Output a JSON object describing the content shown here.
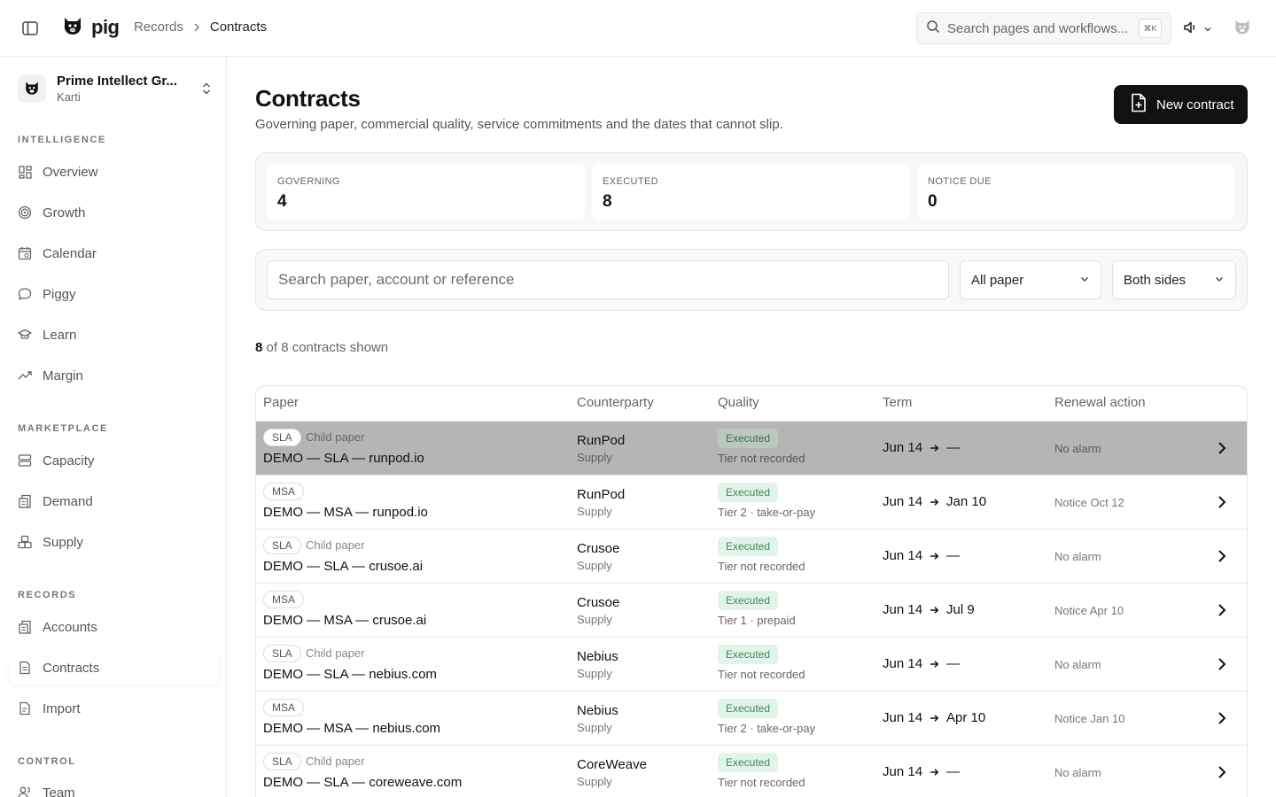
{
  "app": {
    "brand": "pig",
    "breadcrumb": {
      "parent": "Records",
      "current": "Contracts"
    },
    "search": {
      "placeholder": "Search pages and workflows...",
      "shortcut": "⌘K"
    }
  },
  "sidebar": {
    "org": {
      "name": "Prime Intellect Gr...",
      "user": "Karti"
    },
    "sections": {
      "intelligence": "INTELLIGENCE",
      "marketplace": "MARKETPLACE",
      "records": "RECORDS",
      "control": "CONTROL"
    },
    "items": {
      "overview": "Overview",
      "growth": "Growth",
      "calendar": "Calendar",
      "piggy": "Piggy",
      "learn": "Learn",
      "margin": "Margin",
      "capacity": "Capacity",
      "demand": "Demand",
      "supply": "Supply",
      "accounts": "Accounts",
      "contracts": "Contracts",
      "import": "Import",
      "team": "Team"
    }
  },
  "page": {
    "title": "Contracts",
    "subtitle": "Governing paper, commercial quality, service commitments and the dates that cannot slip.",
    "new_button": "New contract"
  },
  "stats": [
    {
      "label": "GOVERNING",
      "value": "4"
    },
    {
      "label": "EXECUTED",
      "value": "8"
    },
    {
      "label": "NOTICE DUE",
      "value": "0"
    }
  ],
  "filters": {
    "search_placeholder": "Search paper, account or reference",
    "paper_select": "All paper",
    "side_select": "Both sides"
  },
  "count": {
    "shown": "8",
    "rest": "of 8 contracts shown"
  },
  "table": {
    "headers": {
      "paper": "Paper",
      "counterparty": "Counterparty",
      "quality": "Quality",
      "term": "Term",
      "renewal": "Renewal action"
    },
    "rows": [
      {
        "type": "SLA",
        "child": "Child paper",
        "name": "DEMO — SLA — runpod.io",
        "counterparty": "RunPod",
        "side": "Supply",
        "status": "Executed",
        "tier": "Tier not recorded",
        "start": "Jun 14",
        "end": "—",
        "renewal": "No alarm"
      },
      {
        "type": "MSA",
        "child": "",
        "name": "DEMO — MSA — runpod.io",
        "counterparty": "RunPod",
        "side": "Supply",
        "status": "Executed",
        "tier": "Tier 2 · take-or-pay",
        "start": "Jun 14",
        "end": "Jan 10",
        "renewal": "Notice Oct 12"
      },
      {
        "type": "SLA",
        "child": "Child paper",
        "name": "DEMO — SLA — crusoe.ai",
        "counterparty": "Crusoe",
        "side": "Supply",
        "status": "Executed",
        "tier": "Tier not recorded",
        "start": "Jun 14",
        "end": "—",
        "renewal": "No alarm"
      },
      {
        "type": "MSA",
        "child": "",
        "name": "DEMO — MSA — crusoe.ai",
        "counterparty": "Crusoe",
        "side": "Supply",
        "status": "Executed",
        "tier": "Tier 1 · prepaid",
        "start": "Jun 14",
        "end": "Jul 9",
        "renewal": "Notice Apr 10"
      },
      {
        "type": "SLA",
        "child": "Child paper",
        "name": "DEMO — SLA — nebius.com",
        "counterparty": "Nebius",
        "side": "Supply",
        "status": "Executed",
        "tier": "Tier not recorded",
        "start": "Jun 14",
        "end": "—",
        "renewal": "No alarm"
      },
      {
        "type": "MSA",
        "child": "",
        "name": "DEMO — MSA — nebius.com",
        "counterparty": "Nebius",
        "side": "Supply",
        "status": "Executed",
        "tier": "Tier 2 · take-or-pay",
        "start": "Jun 14",
        "end": "Apr 10",
        "renewal": "Notice Jan 10"
      },
      {
        "type": "SLA",
        "child": "Child paper",
        "name": "DEMO — SLA — coreweave.com",
        "counterparty": "CoreWeave",
        "side": "Supply",
        "status": "Executed",
        "tier": "Tier not recorded",
        "start": "Jun 14",
        "end": "—",
        "renewal": "No alarm"
      }
    ]
  }
}
